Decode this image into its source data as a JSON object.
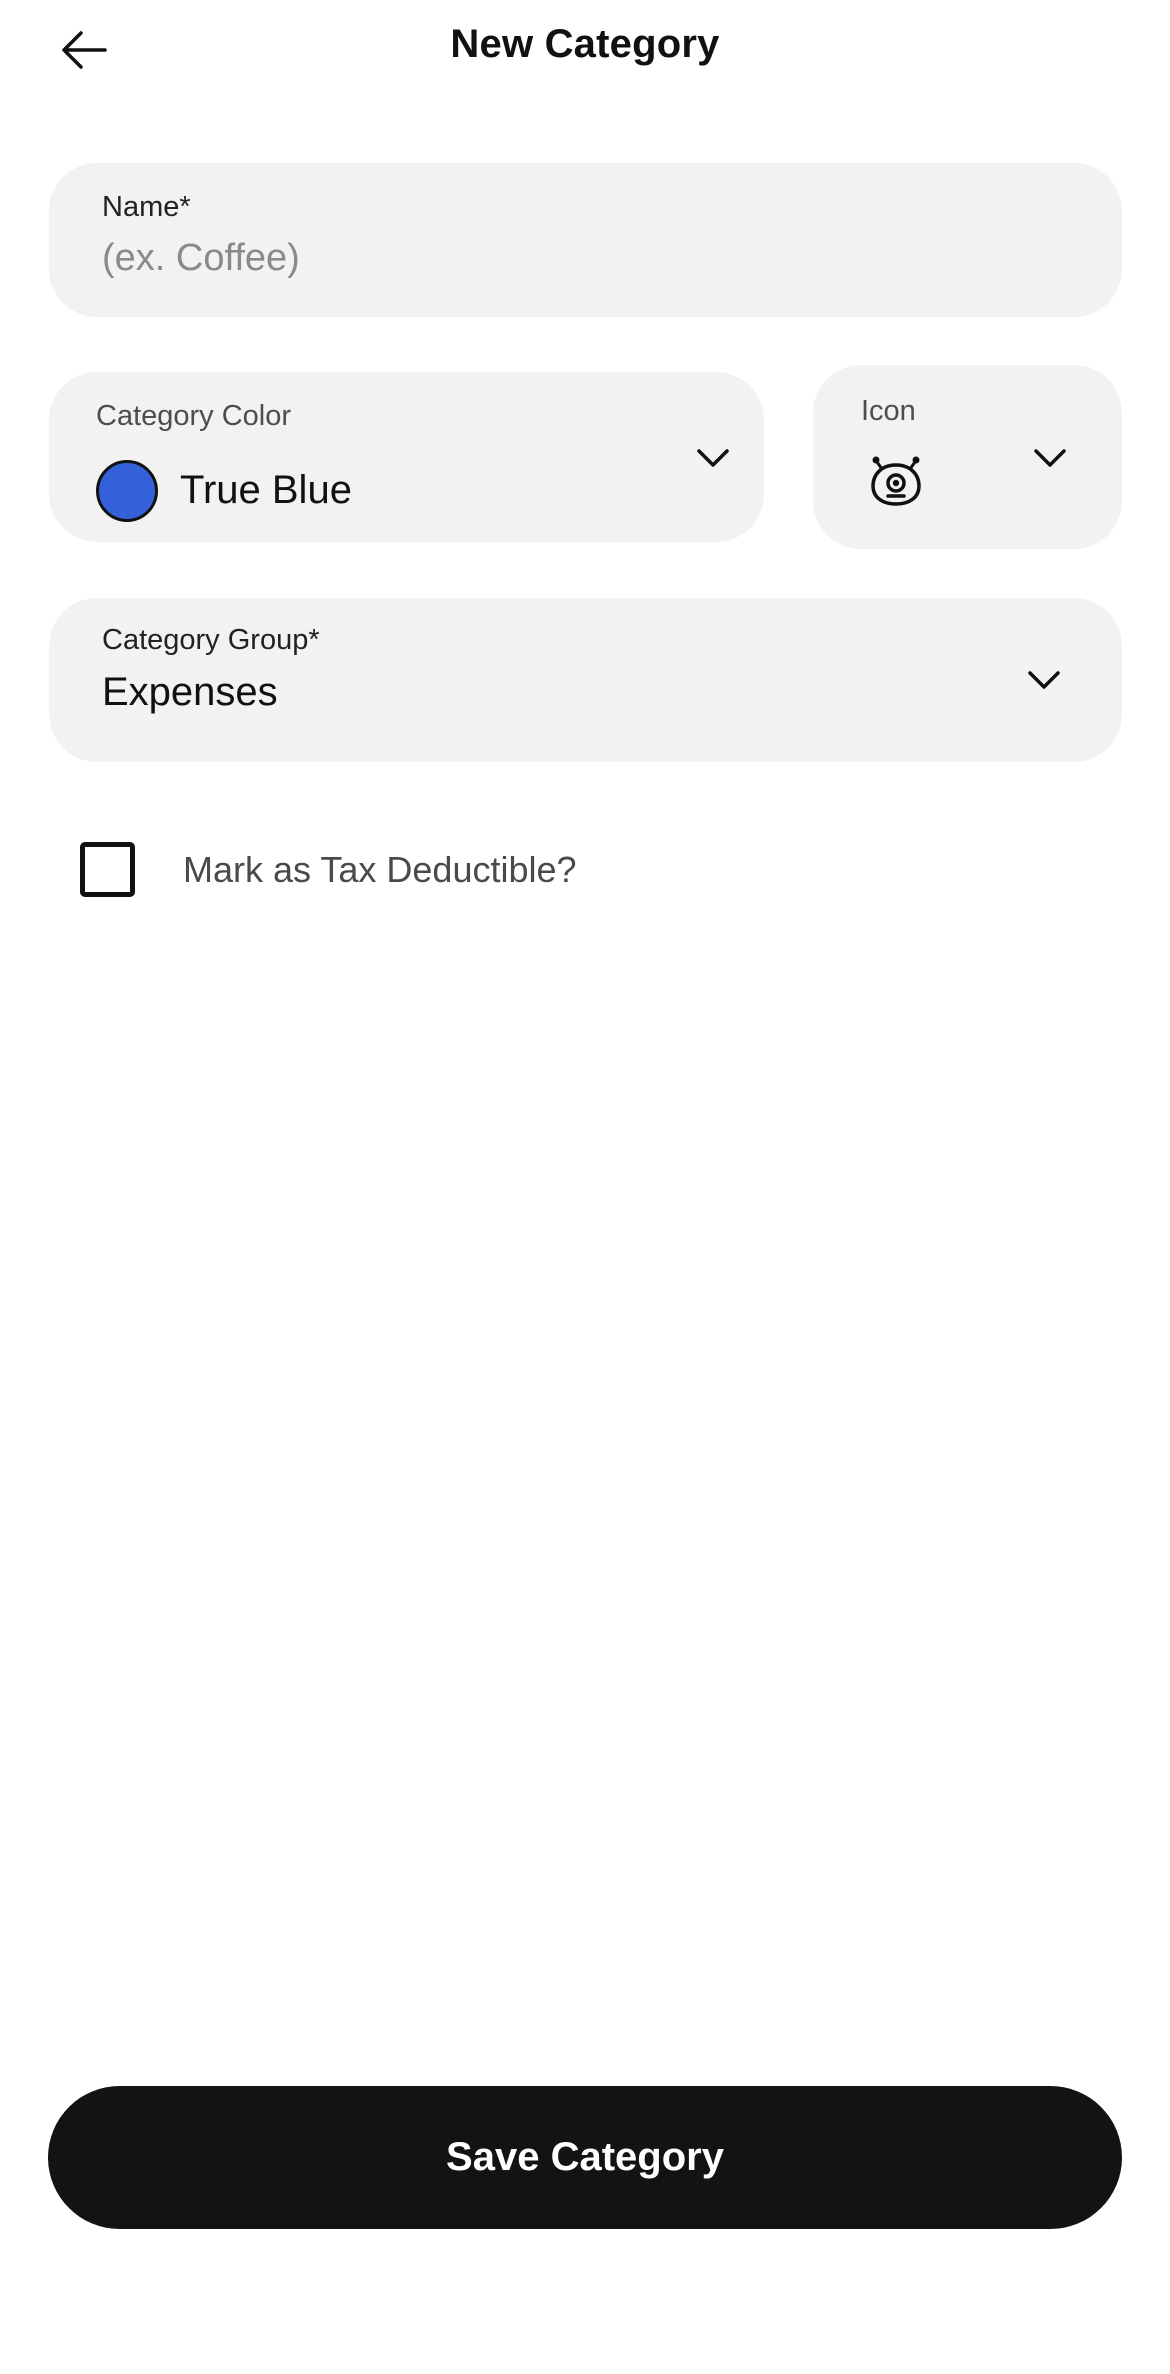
{
  "header": {
    "title": "New Category",
    "back_icon": "arrow-left-icon"
  },
  "name_field": {
    "label": "Name*",
    "value": "",
    "placeholder": "(ex. Coffee)"
  },
  "color_field": {
    "label": "Category Color",
    "value": "True Blue",
    "swatch_color": "#3461d9",
    "dropdown_icon": "chevron-down-icon"
  },
  "icon_field": {
    "label": "Icon",
    "selected_icon": "one-eyed-monster-icon",
    "dropdown_icon": "chevron-down-icon"
  },
  "group_field": {
    "label": "Category Group*",
    "value": "Expenses",
    "dropdown_icon": "chevron-down-icon"
  },
  "tax_checkbox": {
    "label": "Mark as Tax Deductible?",
    "checked": false
  },
  "save_button": {
    "label": "Save Category",
    "background": "#131313"
  }
}
